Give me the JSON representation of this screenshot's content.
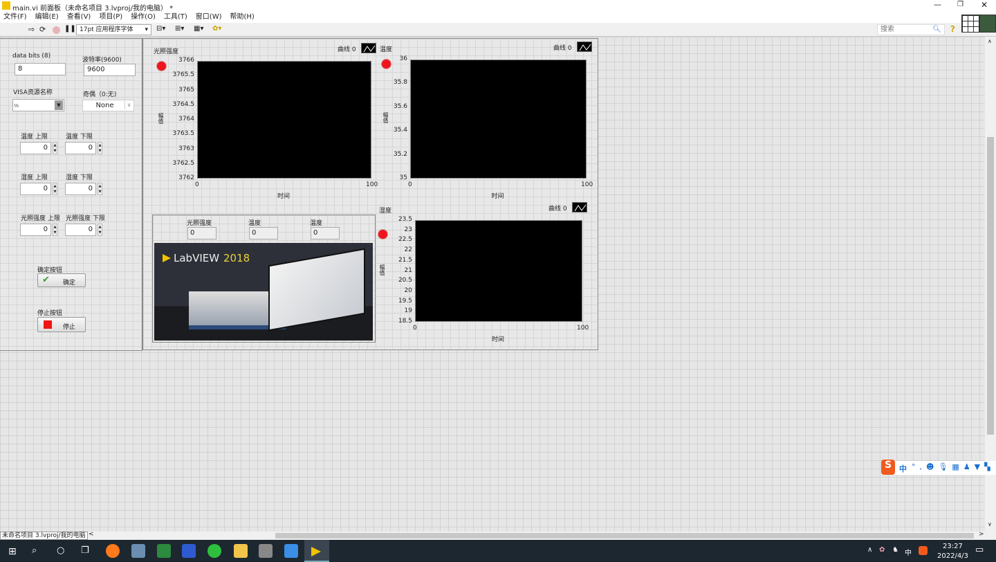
{
  "window": {
    "title": "main.vi 前面板（未命名项目 3.lvproj/我的电脑） *"
  },
  "menu": [
    "文件(F)",
    "编辑(E)",
    "查看(V)",
    "项目(P)",
    "操作(O)",
    "工具(T)",
    "窗口(W)",
    "帮助(H)"
  ],
  "toolbar": {
    "font_select": "17pt 应用程序字体",
    "search_placeholder": "搜索"
  },
  "config": {
    "data_bits_label": "data bits (8)",
    "data_bits_value": "8",
    "baud_label": "波特率(9600)",
    "baud_value": "9600",
    "visa_label": "VISA资源名称",
    "visa_value": "",
    "parity_label": "奇偶（0:无)",
    "parity_value": "None"
  },
  "limits": [
    {
      "upper_label": "温度 上限",
      "upper_value": "0",
      "lower_label": "温度 下限",
      "lower_value": "0"
    },
    {
      "upper_label": "湿度 上限",
      "upper_value": "0",
      "lower_label": "湿度  下限",
      "lower_value": "0"
    },
    {
      "upper_label": "光照强度 上限",
      "upper_value": "0",
      "lower_label": "光照强度  下限",
      "lower_value": "0"
    }
  ],
  "buttons": {
    "ok_label": "确定按钮",
    "ok_text": "确定",
    "stop_label": "停止按钮",
    "stop_text": "停止"
  },
  "indicators": [
    {
      "label": "光照强度",
      "value": "0"
    },
    {
      "label": "温度",
      "value": "0"
    },
    {
      "label": "温度",
      "value": "0"
    }
  ],
  "banner": {
    "brand": "LabVIEW",
    "year": "2018"
  },
  "led_color": "#f0141e",
  "chart_data": [
    {
      "type": "line",
      "title": "光照强度",
      "xlabel": "时间",
      "ylabel": "幅值",
      "legend": "曲线 0",
      "xlim": [
        0,
        100
      ],
      "ylim": [
        3762,
        3766
      ],
      "yticks": [
        "3766",
        "3765.5",
        "3765",
        "3764.5",
        "3764",
        "3763.5",
        "3763",
        "3762.5",
        "3762"
      ],
      "xticks": [
        "0",
        "100"
      ],
      "series": []
    },
    {
      "type": "line",
      "title": "温度",
      "xlabel": "时间",
      "ylabel": "幅值",
      "legend": "曲线 0",
      "xlim": [
        0,
        100
      ],
      "ylim": [
        35,
        36
      ],
      "yticks": [
        "36",
        "35.8",
        "35.6",
        "35.4",
        "35.2",
        "35"
      ],
      "xticks": [
        "0",
        "100"
      ],
      "series": []
    },
    {
      "type": "line",
      "title": "湿度",
      "xlabel": "时间",
      "ylabel": "幅值",
      "legend": "曲线 0",
      "xlim": [
        0,
        100
      ],
      "ylim": [
        18.5,
        23.5
      ],
      "yticks": [
        "23.5",
        "23",
        "22.5",
        "22",
        "21.5",
        "21",
        "20.5",
        "20",
        "19.5",
        "19",
        "18.5"
      ],
      "xticks": [
        "0",
        "100"
      ],
      "series": []
    }
  ],
  "status": {
    "project": "未命名项目 3.lvproj/我的电脑"
  },
  "taskbar": {
    "time": "23:27",
    "date": "2022/4/3",
    "ime": "中"
  },
  "ime_bar": {
    "mode": "中"
  }
}
